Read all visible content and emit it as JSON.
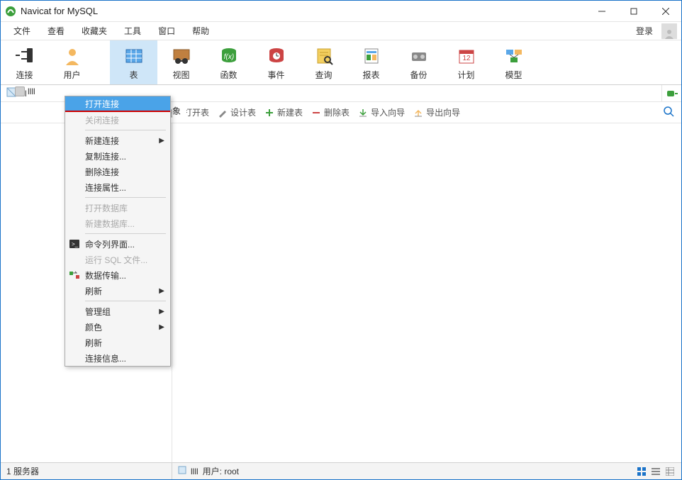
{
  "title": "Navicat for MySQL",
  "menubar": {
    "items": [
      "文件",
      "查看",
      "收藏夹",
      "工具",
      "窗口",
      "帮助"
    ],
    "login": "登录"
  },
  "toolbar": {
    "items": [
      {
        "name": "connection",
        "label": "连接"
      },
      {
        "name": "user",
        "label": "用户"
      },
      {
        "name": "table",
        "label": "表"
      },
      {
        "name": "view",
        "label": "视图"
      },
      {
        "name": "function",
        "label": "函数"
      },
      {
        "name": "event",
        "label": "事件"
      },
      {
        "name": "query",
        "label": "查询"
      },
      {
        "name": "report",
        "label": "报表"
      },
      {
        "name": "backup",
        "label": "备份"
      },
      {
        "name": "schedule",
        "label": "计划"
      },
      {
        "name": "model",
        "label": "模型"
      }
    ],
    "active_index": 2
  },
  "pathbar": {
    "connection_name": "llll"
  },
  "object_tab": {
    "partial_label": "象"
  },
  "objbar": {
    "open_table": "打开表",
    "design_table": "设计表",
    "new_table": "新建表",
    "delete_table": "删除表",
    "import_wizard": "导入向导",
    "export_wizard": "导出向导"
  },
  "tree": {
    "connection": "llll"
  },
  "context_menu": {
    "open_connection": "打开连接",
    "close_connection": "关闭连接",
    "new_connection": "新建连接",
    "copy_connection": "复制连接...",
    "delete_connection": "删除连接",
    "connection_properties": "连接属性...",
    "open_database": "打开数据库",
    "new_database": "新建数据库...",
    "console": "命令列界面...",
    "run_sql_file": "运行 SQL 文件...",
    "data_transfer": "数据传输...",
    "refresh": "刷新",
    "manage_group": "管理组",
    "color": "颜色",
    "refresh2": "刷新",
    "connection_info": "连接信息..."
  },
  "statusbar": {
    "server_count": "1 服务器",
    "connection_label": "llll",
    "user": "用户: root"
  }
}
